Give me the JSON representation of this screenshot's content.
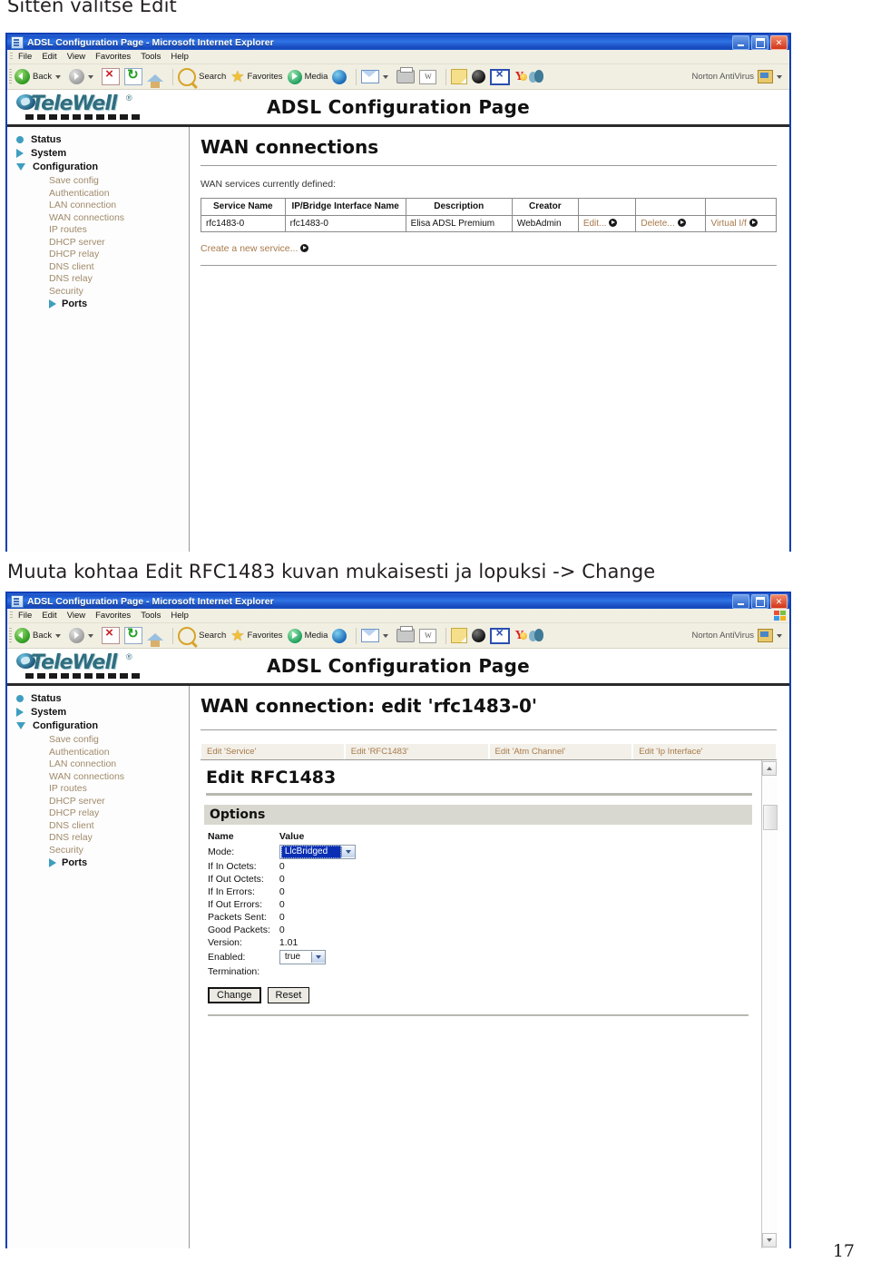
{
  "document": {
    "caption_1": "Sitten valitse Edit",
    "caption_2": "Muuta kohtaa Edit RFC1483 kuvan mukaisesti ja lopuksi -> Change",
    "page_number": "17"
  },
  "browser": {
    "title": "ADSL Configuration Page - Microsoft Internet Explorer",
    "window_buttons": {
      "minimize": "_",
      "maximize": "□",
      "close": "✕"
    },
    "menu": [
      "File",
      "Edit",
      "View",
      "Favorites",
      "Tools",
      "Help"
    ],
    "toolbar": {
      "back": "Back",
      "forward": "",
      "stop": "",
      "refresh": "",
      "home": "",
      "search": "Search",
      "favorites": "Favorites",
      "media": "Media",
      "history": "",
      "norton": "Norton AntiVirus"
    }
  },
  "router": {
    "brand": {
      "name": "TeleWell",
      "registered": "®"
    },
    "header_title": "ADSL Configuration Page",
    "sidebar": {
      "top_items": [
        {
          "label": "Status",
          "marker": "bullet"
        },
        {
          "label": "System",
          "marker": "triangle-right"
        },
        {
          "label": "Configuration",
          "marker": "triangle-down"
        }
      ],
      "sub_items": [
        "Save config",
        "Authentication",
        "LAN connection",
        "WAN connections",
        "IP routes",
        "DHCP server",
        "DHCP relay",
        "DNS client",
        "DNS relay",
        "Security"
      ],
      "ports_label": "Ports"
    }
  },
  "window1": {
    "page_title": "WAN connections",
    "lead": "WAN services currently defined:",
    "table": {
      "headers": [
        "Service Name",
        "IP/Bridge Interface Name",
        "Description",
        "Creator",
        "",
        "",
        ""
      ],
      "rows": [
        {
          "service_name": "rfc1483-0",
          "interface_name": "rfc1483-0",
          "description": "Elisa ADSL Premium",
          "creator": "WebAdmin",
          "edit": "Edit...",
          "delete": "Delete...",
          "virtual": "Virtual I/f"
        }
      ]
    },
    "create_link": "Create a new service..."
  },
  "window2": {
    "page_title": "WAN connection: edit 'rfc1483-0'",
    "tabs": [
      "Edit 'Service'",
      "Edit 'RFC1483'",
      "Edit 'Atm Channel'",
      "Edit 'Ip Interface'"
    ],
    "section_title": "Edit RFC1483",
    "options_title": "Options",
    "options_headers": {
      "name": "Name",
      "value": "Value"
    },
    "options": [
      {
        "name": "Mode:",
        "value": "LlcBridged",
        "type": "select-highlighted"
      },
      {
        "name": "If In Octets:",
        "value": "0",
        "type": "text"
      },
      {
        "name": "If Out Octets:",
        "value": "0",
        "type": "text"
      },
      {
        "name": "If In Errors:",
        "value": "0",
        "type": "text"
      },
      {
        "name": "If Out Errors:",
        "value": "0",
        "type": "text"
      },
      {
        "name": "Packets Sent:",
        "value": "0",
        "type": "text"
      },
      {
        "name": "Good Packets:",
        "value": "0",
        "type": "text"
      },
      {
        "name": "Version:",
        "value": "1.01",
        "type": "text"
      },
      {
        "name": "Enabled:",
        "value": "true",
        "type": "select"
      },
      {
        "name": "Termination:",
        "value": "",
        "type": "text"
      }
    ],
    "buttons": {
      "change": "Change",
      "reset": "Reset"
    }
  },
  "colors": {
    "title_bar": "#1a52c8",
    "window_border": "#0f3fb4",
    "link": "#a8794a",
    "brand": "#2f6e7f",
    "accent": "#3f9ec0",
    "select_highlight": "#0a2fb4"
  }
}
